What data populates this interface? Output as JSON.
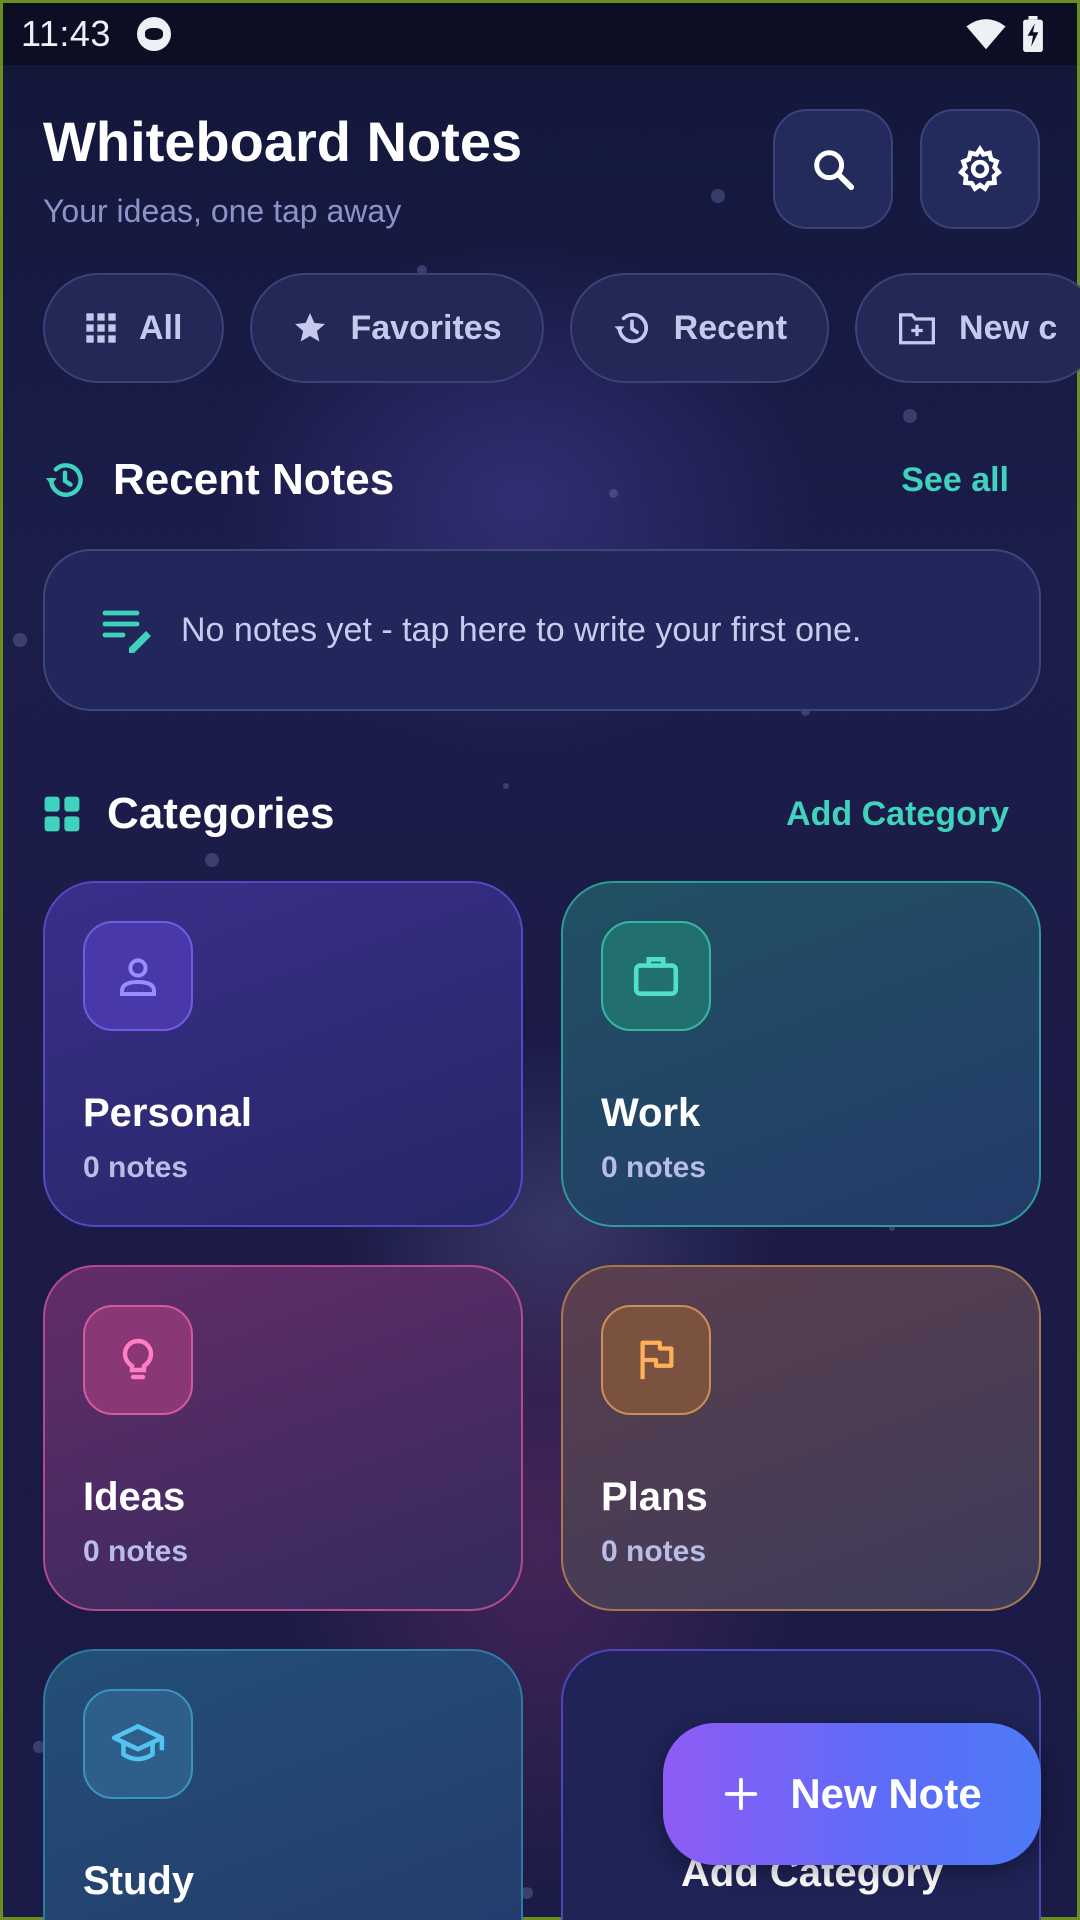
{
  "status_bar": {
    "time": "11:43"
  },
  "header": {
    "title": "Whiteboard Notes",
    "subtitle": "Your ideas, one tap away",
    "search_icon": "search-icon",
    "settings_icon": "gear-icon"
  },
  "filters": [
    {
      "label": "All",
      "icon": "grid-icon"
    },
    {
      "label": "Favorites",
      "icon": "star-icon"
    },
    {
      "label": "Recent",
      "icon": "history-icon"
    },
    {
      "label": "New c",
      "icon": "folder-plus-icon"
    }
  ],
  "recent": {
    "title": "Recent Notes",
    "link": "See all",
    "empty_text": "No notes yet - tap here to write your first one."
  },
  "categories": {
    "title": "Categories",
    "link": "Add Category",
    "items": [
      {
        "name": "Personal",
        "count": "0 notes",
        "icon": "person-icon"
      },
      {
        "name": "Work",
        "count": "0 notes",
        "icon": "briefcase-icon"
      },
      {
        "name": "Ideas",
        "count": "0 notes",
        "icon": "lightbulb-icon"
      },
      {
        "name": "Plans",
        "count": "0 notes",
        "icon": "flag-icon"
      },
      {
        "name": "Study",
        "count": "",
        "icon": "graduation-cap-icon"
      }
    ],
    "add_card_label": "Add Category"
  },
  "fab": {
    "label": "New Note"
  },
  "colors": {
    "accent": "#3fd3bd",
    "background": "#1b1d4b",
    "fab_start": "#8e5cf6",
    "fab_end": "#4d7af7"
  }
}
